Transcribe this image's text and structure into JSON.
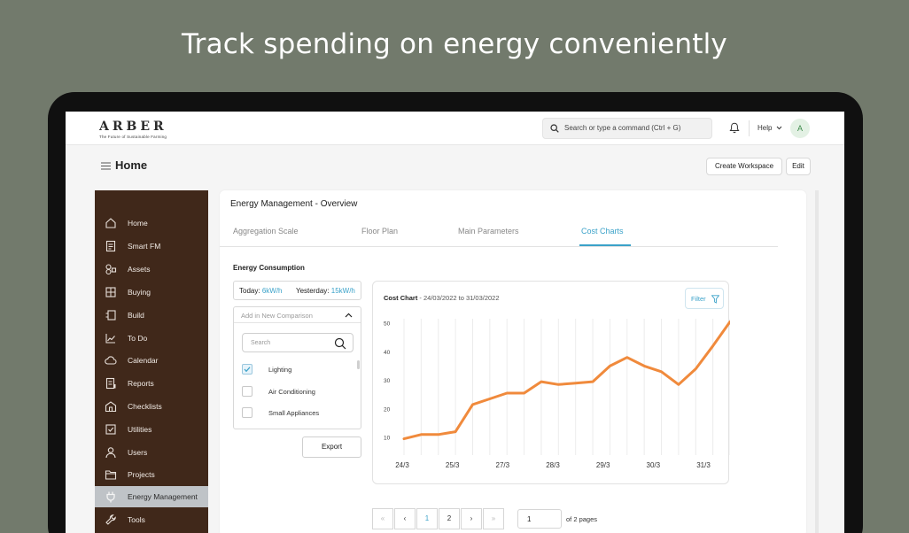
{
  "headline": "Track spending on energy conveniently",
  "app": {
    "brand": "ARBER",
    "tagline": "The Future of Sustainable Farming",
    "search_placeholder": "Search or type a command (Ctrl + G)",
    "help_label": "Help",
    "avatar_initial": "A"
  },
  "page": {
    "title": "Home",
    "create_workspace_label": "Create Workspace",
    "edit_label": "Edit"
  },
  "sidebar": {
    "items": [
      {
        "label": "Home",
        "icon": "home-icon"
      },
      {
        "label": "Smart FM",
        "icon": "document-icon"
      },
      {
        "label": "Assets",
        "icon": "assets-icon"
      },
      {
        "label": "Buying",
        "icon": "grid-icon"
      },
      {
        "label": "Build",
        "icon": "build-icon"
      },
      {
        "label": "To Do",
        "icon": "chart-line-icon"
      },
      {
        "label": "Calendar",
        "icon": "cloud-icon"
      },
      {
        "label": "Reports",
        "icon": "report-icon"
      },
      {
        "label": "Checklists",
        "icon": "building-icon"
      },
      {
        "label": "Utilities",
        "icon": "checkbox-icon"
      },
      {
        "label": "Users",
        "icon": "user-icon"
      },
      {
        "label": "Projects",
        "icon": "folder-icon"
      },
      {
        "label": "Energy Management",
        "icon": "plug-icon",
        "active": true
      },
      {
        "label": "Tools",
        "icon": "wrench-icon"
      }
    ]
  },
  "overview": {
    "title": "Energy Management - Overview",
    "tabs": [
      {
        "label": "Aggregation Scale"
      },
      {
        "label": "Floor Plan"
      },
      {
        "label": "Main Parameters"
      },
      {
        "label": "Cost Charts",
        "active": true
      }
    ],
    "section_label": "Energy Consumption",
    "today_label": "Today:",
    "today_value": "6kW/h",
    "yesterday_label": "Yesterday:",
    "yesterday_value": "15kW/h",
    "comparison_placeholder": "Add in New Comparison",
    "comparison_search_placeholder": "Search",
    "options": [
      {
        "label": "Lighting",
        "checked": true
      },
      {
        "label": "Air Conditioning",
        "checked": false
      },
      {
        "label": "Small Appliances",
        "checked": false
      }
    ],
    "export_label": "Export"
  },
  "chart_panel": {
    "title": "Cost Chart",
    "range_text": " - 24/03/2022 to 31/03/2022",
    "filter_label": "Filter",
    "accent": "#f08a3c"
  },
  "chart_data": {
    "type": "line",
    "title": "Cost Chart - 24/03/2022 to 31/03/2022",
    "x_tick_labels": [
      "24/3",
      "25/3",
      "27/3",
      "28/3",
      "29/3",
      "30/3",
      "31/3"
    ],
    "y_tick_labels": [
      "50",
      "40",
      "30",
      "20",
      "10"
    ],
    "ylim": [
      10,
      50
    ],
    "grid": true,
    "series": [
      {
        "values": [
          9.5,
          11,
          11,
          12,
          21.5,
          23.5,
          25.5,
          25.5,
          29.5,
          28.5,
          29,
          29.5,
          35,
          38,
          35,
          33,
          28.5,
          34,
          42,
          50.5
        ]
      }
    ]
  },
  "pagination": {
    "first": "«",
    "prev": "‹",
    "pages": [
      "1",
      "2"
    ],
    "next": "›",
    "last": "»",
    "current_input": "1",
    "of_text": "of 2 pages"
  }
}
